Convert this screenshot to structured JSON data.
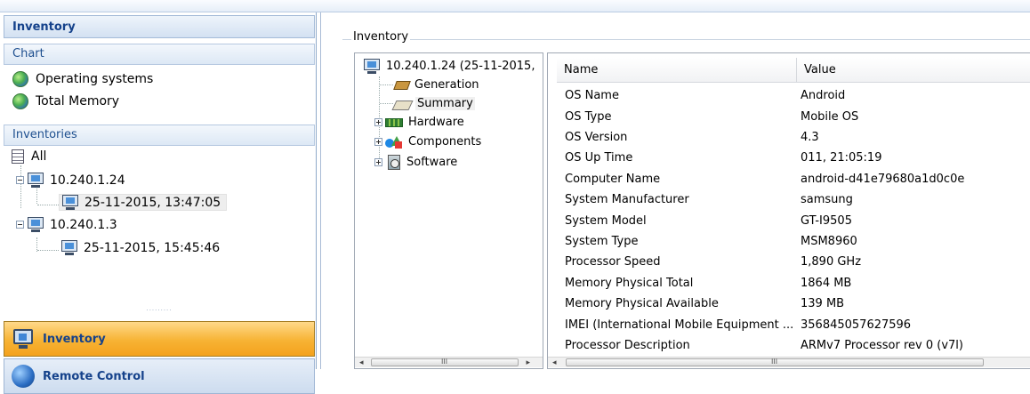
{
  "left_panel": {
    "header": "Inventory",
    "chart_section": {
      "title": "Chart",
      "items": [
        {
          "label": "Operating systems",
          "icon": "globe-icon"
        },
        {
          "label": "Total Memory",
          "icon": "globe-icon"
        }
      ]
    },
    "inventories_section": {
      "title": "Inventories",
      "tree": {
        "all_label": "All",
        "hosts": [
          {
            "label": "10.240.1.24",
            "child": "25-11-2015, 13:47:05",
            "child_selected": true
          },
          {
            "label": "10.240.1.3",
            "child": "25-11-2015, 15:45:46",
            "child_selected": false
          }
        ]
      }
    },
    "nav_buttons": [
      {
        "label": "Inventory",
        "active": true,
        "icon": "monitor-icon"
      },
      {
        "label": "Remote Control",
        "active": false,
        "icon": "remote-globe-icon"
      }
    ]
  },
  "main": {
    "group_title": "Inventory",
    "tree": {
      "root": "10.240.1.24 (25-11-2015,",
      "items": [
        {
          "label": "Generation",
          "icon": "generation-icon",
          "expandable": false
        },
        {
          "label": "Summary",
          "icon": "summary-icon",
          "expandable": false,
          "selected": true
        },
        {
          "label": "Hardware",
          "icon": "hardware-icon",
          "expandable": true
        },
        {
          "label": "Components",
          "icon": "components-icon",
          "expandable": true
        },
        {
          "label": "Software",
          "icon": "software-icon",
          "expandable": true
        }
      ]
    },
    "table": {
      "columns": [
        "Name",
        "Value"
      ],
      "rows": [
        {
          "name": "OS Name",
          "value": "Android"
        },
        {
          "name": "OS Type",
          "value": "Mobile OS"
        },
        {
          "name": "OS Version",
          "value": "4.3"
        },
        {
          "name": "OS Up Time",
          "value": "011, 21:05:19"
        },
        {
          "name": "Computer Name",
          "value": "android-d41e79680a1d0c0e"
        },
        {
          "name": "System Manufacturer",
          "value": "samsung"
        },
        {
          "name": "System Model",
          "value": "GT-I9505"
        },
        {
          "name": "System Type",
          "value": "MSM8960"
        },
        {
          "name": "Processor Speed",
          "value": "1,890 GHz"
        },
        {
          "name": "Memory Physical Total",
          "value": "1864 MB"
        },
        {
          "name": "Memory Physical Available",
          "value": "139 MB"
        },
        {
          "name": "IMEI (International Mobile Equipment ...",
          "value": "356845057627596"
        },
        {
          "name": "Processor Description",
          "value": "ARMv7 Processor rev 0 (v7l)"
        }
      ]
    },
    "scrollbar_grip": "III"
  },
  "colors": {
    "accent_orange": "#f7b334",
    "header_blue": "#15428b",
    "panel_border": "#a4bbd8"
  }
}
